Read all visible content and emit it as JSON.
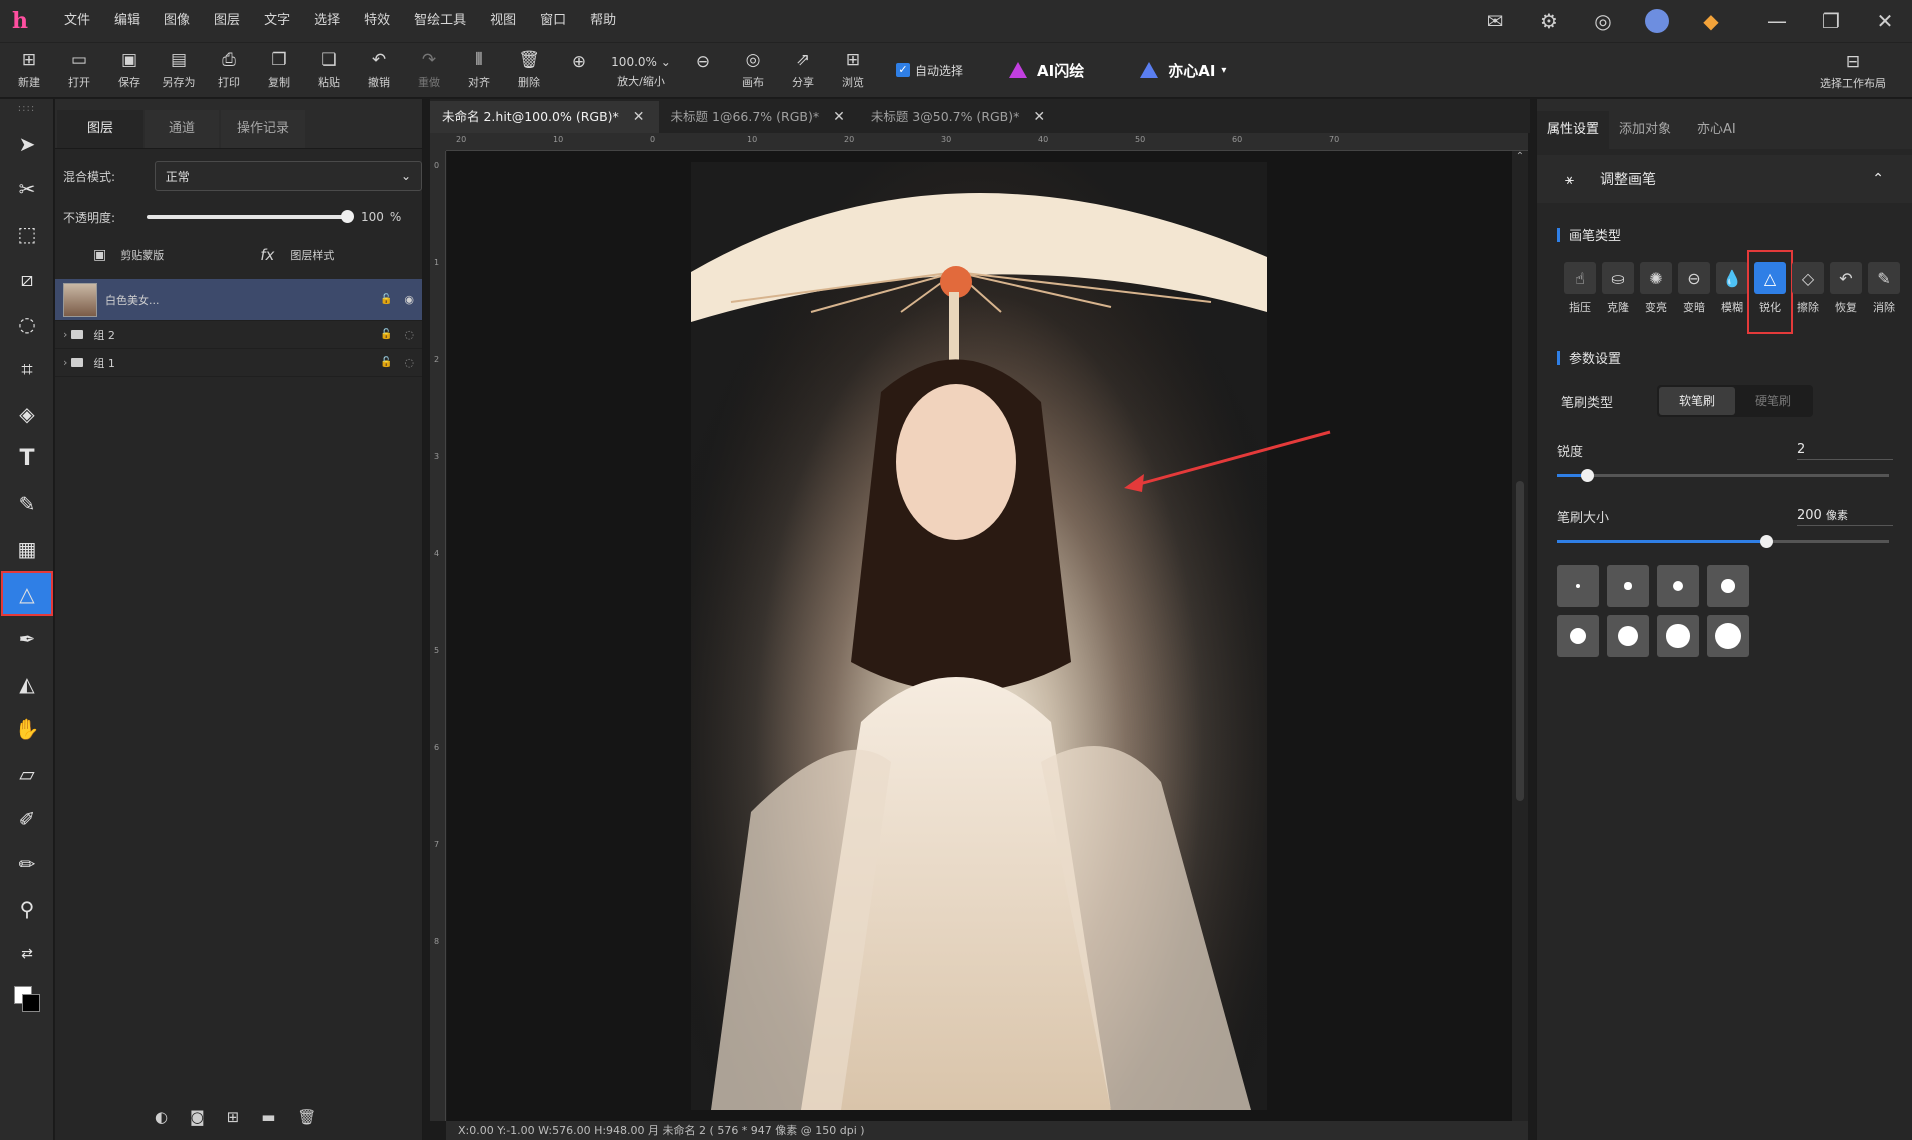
{
  "app": {
    "logo": "h"
  },
  "menu": [
    "文件",
    "编辑",
    "图像",
    "图层",
    "文字",
    "选择",
    "特效",
    "智绘工具",
    "视图",
    "窗口",
    "帮助"
  ],
  "toolbar": {
    "buttons": [
      {
        "label": "新建",
        "icon": "new-file-icon",
        "glyph": "⊞"
      },
      {
        "label": "打开",
        "icon": "folder-open-icon",
        "glyph": "▭"
      },
      {
        "label": "保存",
        "icon": "save-icon",
        "glyph": "▣"
      },
      {
        "label": "另存为",
        "icon": "save-as-icon",
        "glyph": "▤"
      },
      {
        "label": "打印",
        "icon": "print-icon",
        "glyph": "⎙"
      },
      {
        "label": "复制",
        "icon": "copy-icon",
        "glyph": "❐"
      },
      {
        "label": "粘贴",
        "icon": "paste-icon",
        "glyph": "❏"
      },
      {
        "label": "撤销",
        "icon": "undo-icon",
        "glyph": "↶"
      },
      {
        "label": "重做",
        "icon": "redo-icon",
        "glyph": "↷"
      },
      {
        "label": "对齐",
        "icon": "align-icon",
        "glyph": "⫴"
      },
      {
        "label": "删除",
        "icon": "delete-icon",
        "glyph": "🗑"
      }
    ],
    "zoom_value": "100.0%",
    "zoom_label": "放大/缩小",
    "after_zoom": [
      {
        "label": "画布",
        "icon": "canvas-icon",
        "glyph": "◎"
      },
      {
        "label": "分享",
        "icon": "share-icon",
        "glyph": "⇗"
      },
      {
        "label": "浏览",
        "icon": "browse-icon",
        "glyph": "⊞"
      }
    ],
    "auto_select": "自动选择",
    "ai_flash": "AI闪绘",
    "yixin_ai": "亦心AI",
    "layout_label": "选择工作布局"
  },
  "layers_panel": {
    "tabs": [
      "图层",
      "通道",
      "操作记录"
    ],
    "blend_label": "混合模式:",
    "blend_value": "正常",
    "opacity_label": "不透明度:",
    "opacity_value": "100",
    "opacity_unit": "%",
    "opacity_fraction": 1.0,
    "clip_label": "剪贴蒙版",
    "style_label": "图层样式",
    "layers": [
      {
        "name": "白色美女...",
        "type": "image"
      },
      {
        "name": "组 2",
        "type": "group"
      },
      {
        "name": "组 1",
        "type": "group"
      }
    ]
  },
  "documents": {
    "tabs": [
      {
        "title": "未命名 2.hit@100.0% (RGB)*"
      },
      {
        "title": "未标题 1@66.7% (RGB)*"
      },
      {
        "title": "未标题 3@50.7% (RGB)*"
      }
    ],
    "ruler_h": [
      "20",
      "10",
      "0",
      "10",
      "20",
      "30",
      "40",
      "50",
      "60",
      "70"
    ],
    "ruler_v": [
      "0",
      "1",
      "2",
      "3",
      "4",
      "5",
      "6",
      "7",
      "8"
    ],
    "status": "X:0.00 Y:-1.00 W:576.00 H:948.00 月    未命名 2 ( 576 * 947 像素 @ 150 dpi )"
  },
  "right_panel": {
    "tabs": [
      "属性设置",
      "添加对象",
      "亦心AI"
    ],
    "section_title": "调整画笔",
    "brush_type_label": "画笔类型",
    "brush_types": [
      {
        "label": "指压",
        "icon": "smudge-icon",
        "glyph": "☝"
      },
      {
        "label": "克隆",
        "icon": "clone-stamp-icon",
        "glyph": "⛀"
      },
      {
        "label": "变亮",
        "icon": "dodge-icon",
        "glyph": "✺"
      },
      {
        "label": "变暗",
        "icon": "burn-icon",
        "glyph": "⊖"
      },
      {
        "label": "模糊",
        "icon": "blur-drop-icon",
        "glyph": "💧"
      },
      {
        "label": "锐化",
        "icon": "sharpen-icon",
        "glyph": "△"
      },
      {
        "label": "擦除",
        "icon": "eraser-icon",
        "glyph": "◇"
      },
      {
        "label": "恢复",
        "icon": "restore-icon",
        "glyph": "↶"
      },
      {
        "label": "消除",
        "icon": "remove-icon",
        "glyph": "✎"
      }
    ],
    "selected_brush": "锐化",
    "params_label": "参数设置",
    "brush_kind_label": "笔刷类型",
    "soft_brush": "软笔刷",
    "hard_brush": "硬笔刷",
    "sharpness_label": "锐度",
    "sharpness_value": "2",
    "sharpness_fraction": 0.09,
    "size_label": "笔刷大小",
    "size_value": "200",
    "size_unit": "像素",
    "size_fraction": 0.63,
    "swatch_count": 8
  },
  "colors": {
    "accent": "#2f7fe6",
    "highlight": "#e43a3a",
    "layer_active": "#3d4a6b"
  }
}
